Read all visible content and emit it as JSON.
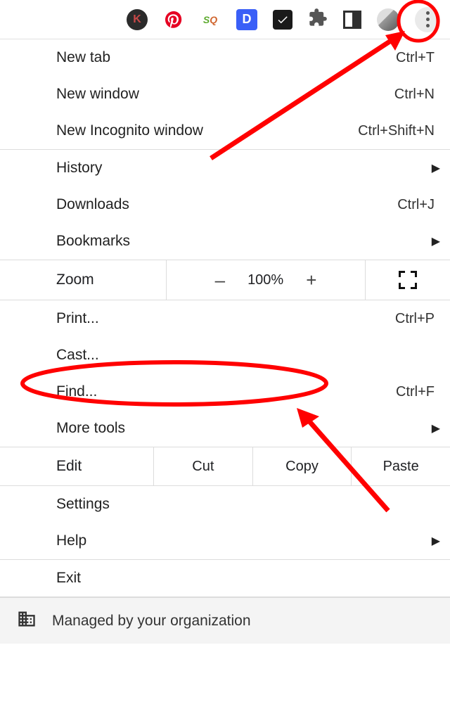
{
  "toolbar": {
    "icons": [
      "K",
      "pinterest",
      "sq",
      "D",
      "check",
      "extensions",
      "tablet",
      "avatar",
      "more"
    ]
  },
  "menu": {
    "new_tab": {
      "label": "New tab",
      "shortcut": "Ctrl+T"
    },
    "new_window": {
      "label": "New window",
      "shortcut": "Ctrl+N"
    },
    "new_incognito": {
      "label": "New Incognito window",
      "shortcut": "Ctrl+Shift+N"
    },
    "history": {
      "label": "History"
    },
    "downloads": {
      "label": "Downloads",
      "shortcut": "Ctrl+J"
    },
    "bookmarks": {
      "label": "Bookmarks"
    },
    "zoom": {
      "label": "Zoom",
      "value": "100%",
      "minus": "–",
      "plus": "+"
    },
    "print": {
      "label": "Print...",
      "shortcut": "Ctrl+P"
    },
    "cast": {
      "label": "Cast..."
    },
    "find": {
      "label": "Find...",
      "shortcut": "Ctrl+F"
    },
    "more_tools": {
      "label": "More tools"
    },
    "edit": {
      "label": "Edit",
      "cut": "Cut",
      "copy": "Copy",
      "paste": "Paste"
    },
    "settings": {
      "label": "Settings"
    },
    "help": {
      "label": "Help"
    },
    "exit": {
      "label": "Exit"
    },
    "managed": {
      "label": "Managed by your organization"
    }
  }
}
